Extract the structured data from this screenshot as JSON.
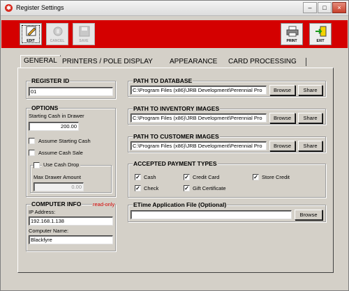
{
  "window": {
    "title": "Register Settings",
    "minimize": "–",
    "maximize": "□",
    "close": "×"
  },
  "toolbar": {
    "edit": "EDIT",
    "cancel": "CANCEL",
    "save": "SAVE",
    "print": "PRINT",
    "exit": "EXIT",
    "color": "#d40000"
  },
  "tabs": [
    "GENERAL",
    "PRINTERS / POLE DISPLAY",
    "APPEARANCE",
    "CARD PROCESSING"
  ],
  "register": {
    "title": "REGISTER ID",
    "value": "01"
  },
  "options": {
    "title": "OPTIONS",
    "starting_cash_label": "Starting Cash in Drawer",
    "starting_cash_value": "200.00",
    "assume_starting_cash": "Assume Starting Cash",
    "assume_cash_sale": "Assume Cash Sale",
    "use_cash_drop": "Use Cash Drop",
    "max_drawer_label": "Max Drawer Amount",
    "max_drawer_value": "0.00"
  },
  "computer": {
    "title": "COMPUTER INFO",
    "readonly": "read-only",
    "ip_label": "IP Address:",
    "ip_value": "192.168.1.138",
    "name_label": "Computer Name:",
    "name_value": "Blackfyre"
  },
  "paths": [
    {
      "title": "PATH TO DATABASE",
      "value": "C:\\Program Files (x86)\\JRB Development\\Perennial Pro",
      "browse": "Browse",
      "share": "Share"
    },
    {
      "title": "PATH TO INVENTORY IMAGES",
      "value": "C:\\Program Files (x86)\\JRB Development\\Perennial Pro",
      "browse": "Browse",
      "share": "Share"
    },
    {
      "title": "PATH TO CUSTOMER IMAGES",
      "value": "C:\\Program Files (x86)\\JRB Development\\Perennial Pro",
      "browse": "Browse",
      "share": "Share"
    }
  ],
  "payments": {
    "title": "ACCEPTED PAYMENT TYPES",
    "items": [
      {
        "label": "Cash",
        "checked": "✓"
      },
      {
        "label": "Credit Card",
        "checked": "✓"
      },
      {
        "label": "Store Credit",
        "checked": "✓"
      },
      {
        "label": "Check",
        "checked": "✓"
      },
      {
        "label": "Gift Certificate",
        "checked": "✓"
      }
    ]
  },
  "etime": {
    "title": "ETime Application File (Optional)",
    "value": "",
    "browse": "Browse"
  }
}
